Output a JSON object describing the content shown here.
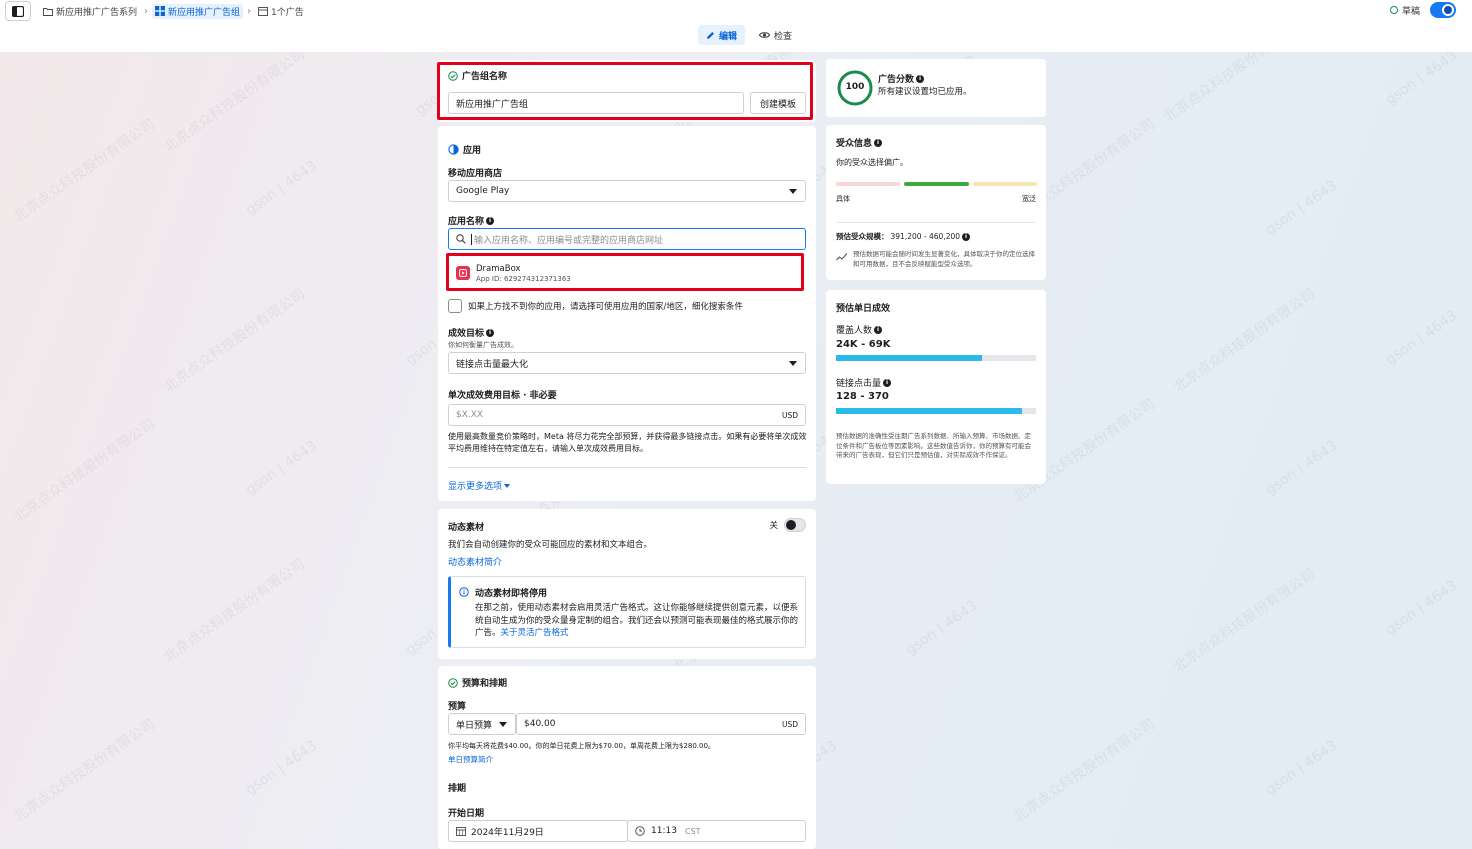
{
  "breadcrumb": {
    "campaign": "新应用推广广告系列",
    "adset": "新应用推广广告组",
    "ad": "1个广告"
  },
  "status": {
    "draft_label": "草稿"
  },
  "mode_tabs": {
    "edit": "编辑",
    "review": "检查"
  },
  "adset_name": {
    "section_title": "广告组名称",
    "value": "新应用推广广告组",
    "create_template_button": "创建模板"
  },
  "app": {
    "section_title": "应用",
    "store_label": "移动应用商店",
    "store_value": "Google Play",
    "app_name_label": "应用名称",
    "search_placeholder": "输入应用名称、应用编号或完整的应用商店网址",
    "result_name": "DramaBox",
    "result_id": "App ID: 629274312371363",
    "not_found_checkbox_label": "如果上方找不到你的应用，请选择可使用应用的国家/地区，细化搜索条件",
    "goal_label": "成效目标",
    "goal_sub": "你如何衡量广告成效。",
    "goal_value": "链接点击量最大化",
    "cost_goal_label": "单次成效费用目标 · 非必要",
    "cost_placeholder": "$X.XX",
    "cost_currency": "USD",
    "cost_help": "使用最高数量竞价策略时，Meta 将尽力花完全部预算，并获得最多链接点击。如果有必要将单次成效平均费用维持在特定值左右，请输入单次成效费用目标。",
    "more_options_link": "显示更多选项"
  },
  "dynamic_creative": {
    "title": "动态素材",
    "toggle_label": "关",
    "description": "我们会自动创建你的受众可能回应的素材和文本组合。",
    "intro_link": "动态素材简介",
    "notice_title": "动态素材即将停用",
    "notice_body": "在那之前，使用动态素材会启用灵活广告格式。这让你能够继续提供创意元素，以便系统自动生成为你的受众量身定制的组合。我们还会以预测可能表现最佳的格式展示你的广告。",
    "notice_link": "关于灵活广告格式"
  },
  "budget": {
    "section_title": "预算和排期",
    "budget_label": "预算",
    "budget_type": "单日预算",
    "budget_value": "$40.00",
    "currency": "USD",
    "budget_help": "你平均每天将花费$40.00。你的单日花费上限为$70.00，单周花费上限为$280.00。",
    "budget_link": "单日预算简介",
    "schedule_label": "排期",
    "start_date_label": "开始日期",
    "start_date": "2024年11月29日",
    "start_time": "11:13",
    "timezone": "CST"
  },
  "ad_score": {
    "score": "100",
    "title": "广告分数",
    "subtitle": "所有建议设置均已应用。",
    "ring_fraction": 1.0,
    "ring_color": "#1b8a4f"
  },
  "audience": {
    "title": "受众信息",
    "subtitle": "你的受众选择偏广。",
    "specific_label": "具体",
    "broad_label": "宽泛",
    "size_label": "预估受众规模：",
    "size_value": "391,200 - 460,200",
    "note": "预估数据可能会随时间发生显著变化，具体取决于你的定位选择和可用数据，且不会反映赋能型受众选项。"
  },
  "daily_results": {
    "title": "预估单日成效",
    "reach_label": "覆盖人数",
    "reach_value": "24K - 69K",
    "reach_fraction": 0.73,
    "clicks_label": "链接点击量",
    "clicks_value": "128 - 370",
    "clicks_fraction": 0.93,
    "note": "预估数据的准确性受往期广告系列数据、所输入预算、市场数据、定位条件和广告板位等因素影响。这些数值告诉你，你的预算有可能会带来的广告表现，但它们只是预估值，对实际成效不作保证。"
  },
  "watermark_text": "北京点众科技股份有限公司",
  "watermark_text2": "gson | 4643"
}
